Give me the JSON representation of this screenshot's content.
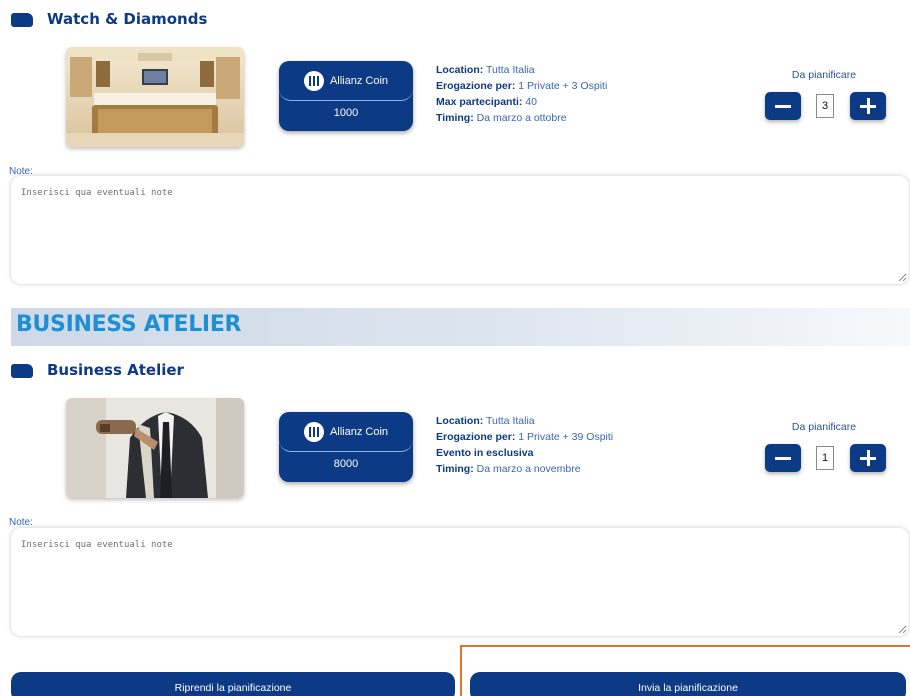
{
  "items": [
    {
      "title": "Watch & Diamonds",
      "coin": {
        "brand": "Allianz Coin",
        "value": "1000"
      },
      "details": [
        {
          "label": "Location:",
          "value": "Tutta Italia"
        },
        {
          "label": "Erogazione per:",
          "value": "1 Private + 3 Ospiti"
        },
        {
          "label": "Max partecipanti:",
          "value": "40"
        },
        {
          "label": "Timing:",
          "value": "Da marzo a ottobre"
        }
      ],
      "plan_label": "Da pianificare",
      "quantity": "3",
      "note_label": "Note:",
      "note_placeholder": "Inserisci qua eventuali note"
    },
    {
      "title": "Business Atelier",
      "coin": {
        "brand": "Allianz Coin",
        "value": "8000"
      },
      "details": [
        {
          "label": "Location:",
          "value": "Tutta Italia"
        },
        {
          "label": "Erogazione per:",
          "value": "1 Private + 39 Ospiti"
        },
        {
          "label": "Evento in esclusiva",
          "value": ""
        },
        {
          "label": "Timing:",
          "value": "Da marzo a novembre"
        }
      ],
      "plan_label": "Da pianificare",
      "quantity": "1",
      "note_label": "Note:",
      "note_placeholder": "Inserisci qua eventuali note"
    }
  ],
  "section": {
    "title": "BUSINESS ATELIER"
  },
  "buttons": {
    "resume": "Riprendi la pianificazione",
    "send": "Invia la pianificazione"
  },
  "colors": {
    "primary": "#0d3a85",
    "section_title": "#1f8fd4",
    "highlight": "#e5742a"
  }
}
